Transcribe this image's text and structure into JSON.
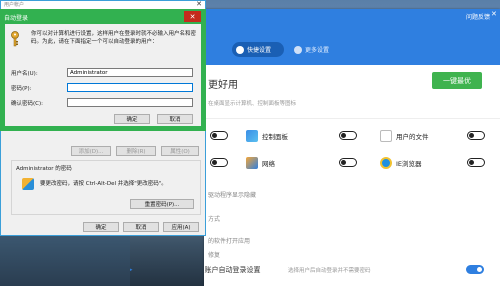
{
  "app": {
    "title": "问题反馈",
    "close_glyph": "✕",
    "tabs": [
      {
        "label": "快捷设置",
        "active": true
      },
      {
        "label": "更多设置",
        "active": false
      }
    ],
    "section_title": "更好用",
    "section_sub": "在桌面显示计算机、控制面板等图标",
    "optimize_button": "一键最优",
    "items": [
      {
        "label": "控制面板",
        "icon": "control-panel-icon",
        "toggle": false
      },
      {
        "label": "用户的文件",
        "icon": "user-folder-icon",
        "toggle": false
      },
      {
        "label": "网络",
        "icon": "network-icon",
        "toggle": false
      },
      {
        "label": "IE浏览器",
        "icon": "ie-browser-icon",
        "toggle": false
      }
    ],
    "rows": [
      "驱动程序显示隐藏",
      "方式",
      "的软件打开应用",
      "修复"
    ],
    "last_row": {
      "label": "账户自动登录设置",
      "sub": "选择用户后自动登录并不需要密码",
      "toggle": true
    }
  },
  "dialog": {
    "title": "用户帐户",
    "close_glyph": "✕",
    "buttons_row": [
      "添加(D)...",
      "删除(R)",
      "属性(O)"
    ],
    "password_group_label": "Administrator 的密码",
    "password_text": "要更改密码，请按 Ctrl-Alt-Del 并选择\"更改密码\"。",
    "reset_password_button": "重置密码(P)...",
    "footer_buttons": [
      "确定",
      "取消",
      "应用(A)"
    ]
  },
  "autologon": {
    "title": "自动登录",
    "close_glyph": "✕",
    "description": "你可以对计算机进行设置，这样用户在登录时就不必输入用户名和密码。为此，请在下面指定一个可以自动登录的用户：",
    "fields": [
      {
        "label": "用户名(U):",
        "value": "Administrator"
      },
      {
        "label": "密码(P):",
        "value": ""
      },
      {
        "label": "确认密码(C):",
        "value": ""
      }
    ],
    "ok": "确定",
    "cancel": "取消"
  }
}
